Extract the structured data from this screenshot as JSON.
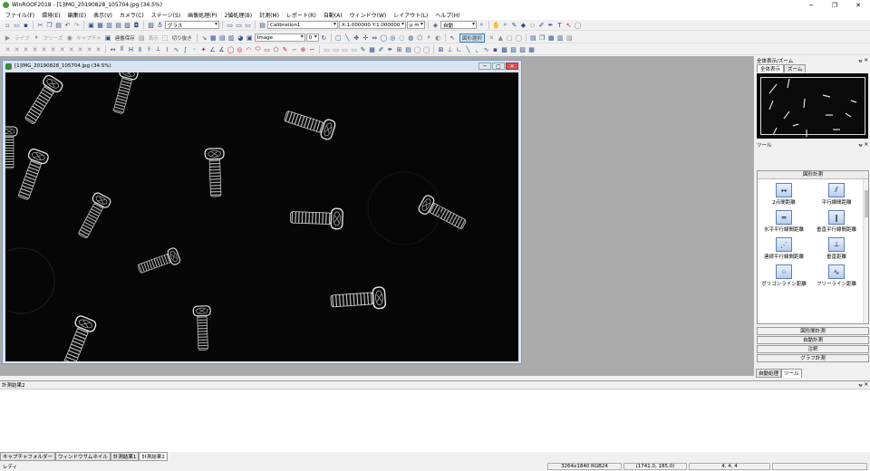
{
  "window": {
    "title": "WinROOF2018 - [1]IMG_20190828_105704.jpg (34.5%)"
  },
  "menu": [
    "ファイル(F)",
    "環境(E)",
    "編集(E)",
    "表示(V)",
    "カメラ(C)",
    "ステージ(S)",
    "画像処理(P)",
    "2値処理(B)",
    "計測(M)",
    "レポート(R)",
    "自動(A)",
    "ウィンドウ(W)",
    "レイアウト(L)",
    "ヘルプ(H)"
  ],
  "toolbar1": {
    "interp_combo": "グラス",
    "calibration_combo": "Calibration1",
    "scale_value": "X:1.000000 Y:1.000000",
    "unit_combo": "μ m",
    "auto_combo": "自動"
  },
  "toolbar2": {
    "live_label": "ライブ",
    "freeze_label": "フリーズ",
    "capture_label": "キャプチャ",
    "save_label": "連番保存",
    "edit_label": "表示",
    "cutout_label": "切り抜き",
    "image_combo": "Image",
    "zoom_value": "0",
    "select_label": "図形選択"
  },
  "image_window": {
    "title": "[1]IMG_20190828_105704.jpg (34.5%)"
  },
  "right_panel": {
    "overview_title": "全体表示/ズーム",
    "overview_tabs": [
      "全体表示",
      "ズーム"
    ],
    "tools_title": "ツール",
    "group_title": "図形計測",
    "tools": [
      {
        "label": "2点間距離",
        "icon": "two-point-distance-icon"
      },
      {
        "label": "平行線間距離",
        "icon": "parallel-line-distance-icon"
      },
      {
        "label": "水平平行線間距離",
        "icon": "horizontal-parallel-distance-icon"
      },
      {
        "label": "垂直平行線間距離",
        "icon": "vertical-parallel-distance-icon"
      },
      {
        "label": "連続平行線間距離",
        "icon": "continuous-parallel-distance-icon"
      },
      {
        "label": "垂直距離",
        "icon": "perpendicular-distance-icon"
      },
      {
        "label": "ポリゴンライン距離",
        "icon": "polygon-line-distance-icon"
      },
      {
        "label": "フリーライン距離",
        "icon": "free-line-distance-icon"
      }
    ],
    "groups": [
      "図形間計測",
      "自動計測",
      "注釈",
      "グラフ計測"
    ],
    "bottom_tabs": [
      "自動処理",
      "ツール"
    ]
  },
  "results": {
    "title": "計測結果2"
  },
  "doc_tabs": [
    "キャプチャフォルダー",
    "ウィンドウサムネイル",
    "計測結果1",
    "計測結果2"
  ],
  "status": {
    "ready": "レディ",
    "image_info": "3264x1840 RGB24",
    "coords": "(1741.0, 185.0)",
    "values": "4, 4, 4"
  }
}
